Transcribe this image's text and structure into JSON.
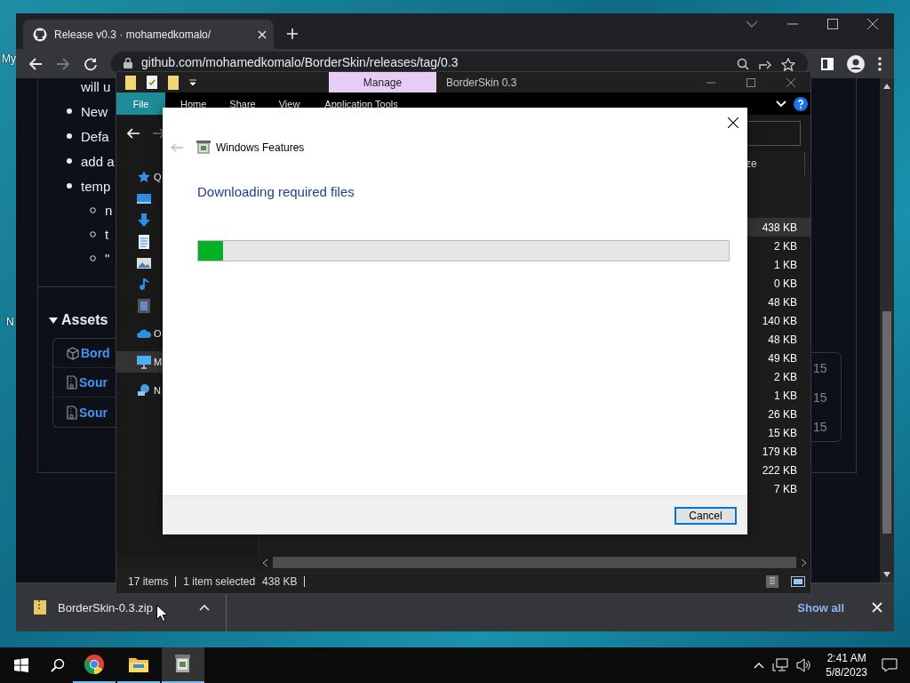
{
  "desktop": {
    "icons": [
      {
        "label": "My"
      },
      {
        "label": "N"
      }
    ]
  },
  "browser": {
    "tab": {
      "title": "Release v0.3 · mohamedkomalo/"
    },
    "address": "github.com/mohamedkomalo/BorderSkin/releases/tag/0.3",
    "notes": [
      {
        "kind": "text",
        "text": "will u"
      },
      {
        "kind": "bullet",
        "text": "New"
      },
      {
        "kind": "bullet",
        "text": "Defa"
      },
      {
        "kind": "bullet",
        "text": "add a"
      },
      {
        "kind": "bullet",
        "text": "temp"
      },
      {
        "kind": "subbullet",
        "text": "n"
      },
      {
        "kind": "subbullet",
        "text": "t"
      },
      {
        "kind": "subbullet",
        "text": "\""
      }
    ],
    "assets": {
      "heading": "Assets",
      "expanded": true,
      "rows": [
        {
          "kind": "package",
          "name": "Bord",
          "tail": "15"
        },
        {
          "kind": "zip",
          "name": "Sour",
          "tail": "15"
        },
        {
          "kind": "zip",
          "name": "Sour",
          "tail": "15"
        }
      ]
    },
    "download": {
      "file": "BorderSkin-0.3.zip"
    },
    "show_all": "Show all"
  },
  "explorer": {
    "context_tab": "Manage",
    "title": "BorderSkin 0.3",
    "ribbon": [
      {
        "kind": "file",
        "label": "File"
      },
      {
        "kind": "tab",
        "label": "Home"
      },
      {
        "kind": "tab",
        "label": "Share"
      },
      {
        "kind": "tab",
        "label": "View"
      },
      {
        "kind": "context",
        "label": "Application Tools"
      }
    ],
    "nav": [
      {
        "kind": "quick",
        "label": "Q",
        "selected": false
      },
      {
        "kind": "desktop",
        "selected": false
      },
      {
        "kind": "downloads",
        "selected": false
      },
      {
        "kind": "documents",
        "selected": false
      },
      {
        "kind": "pictures",
        "selected": false
      },
      {
        "kind": "music",
        "selected": false
      },
      {
        "kind": "videos",
        "selected": false
      },
      {
        "kind": "onedrive",
        "label": "O",
        "selected": false
      },
      {
        "kind": "pc",
        "label": "M",
        "selected": true
      },
      {
        "kind": "network",
        "label": "N",
        "selected": false
      }
    ],
    "size_header": "ze",
    "sizes": [
      {
        "text": "438 KB",
        "selected": true
      },
      {
        "text": "2 KB",
        "selected": false
      },
      {
        "text": "1 KB",
        "selected": false
      },
      {
        "text": "0 KB",
        "selected": false
      },
      {
        "text": "48 KB",
        "selected": false
      },
      {
        "text": "140 KB",
        "selected": false
      },
      {
        "text": "48 KB",
        "selected": false
      },
      {
        "text": "49 KB",
        "selected": false
      },
      {
        "text": "2 KB",
        "selected": false
      },
      {
        "text": "1 KB",
        "selected": false
      },
      {
        "text": "26 KB",
        "selected": false
      },
      {
        "text": "15 KB",
        "selected": false
      },
      {
        "text": "179 KB",
        "selected": false
      },
      {
        "text": "222 KB",
        "selected": false
      },
      {
        "text": "7 KB",
        "selected": false
      }
    ],
    "status": {
      "count": "17 items",
      "selection": "1 item selected",
      "size": "438 KB"
    }
  },
  "dialog": {
    "title": "Windows Features",
    "heading": "Downloading required files",
    "progress": {
      "level": 0.047
    },
    "cancel": "Cancel"
  },
  "taskbar": {
    "apps": [
      {
        "kind": "chrome",
        "active": false
      },
      {
        "kind": "explorer",
        "active": false
      },
      {
        "kind": "features",
        "active": true
      }
    ],
    "time": "2:41 AM",
    "date": "5/8/2023"
  }
}
